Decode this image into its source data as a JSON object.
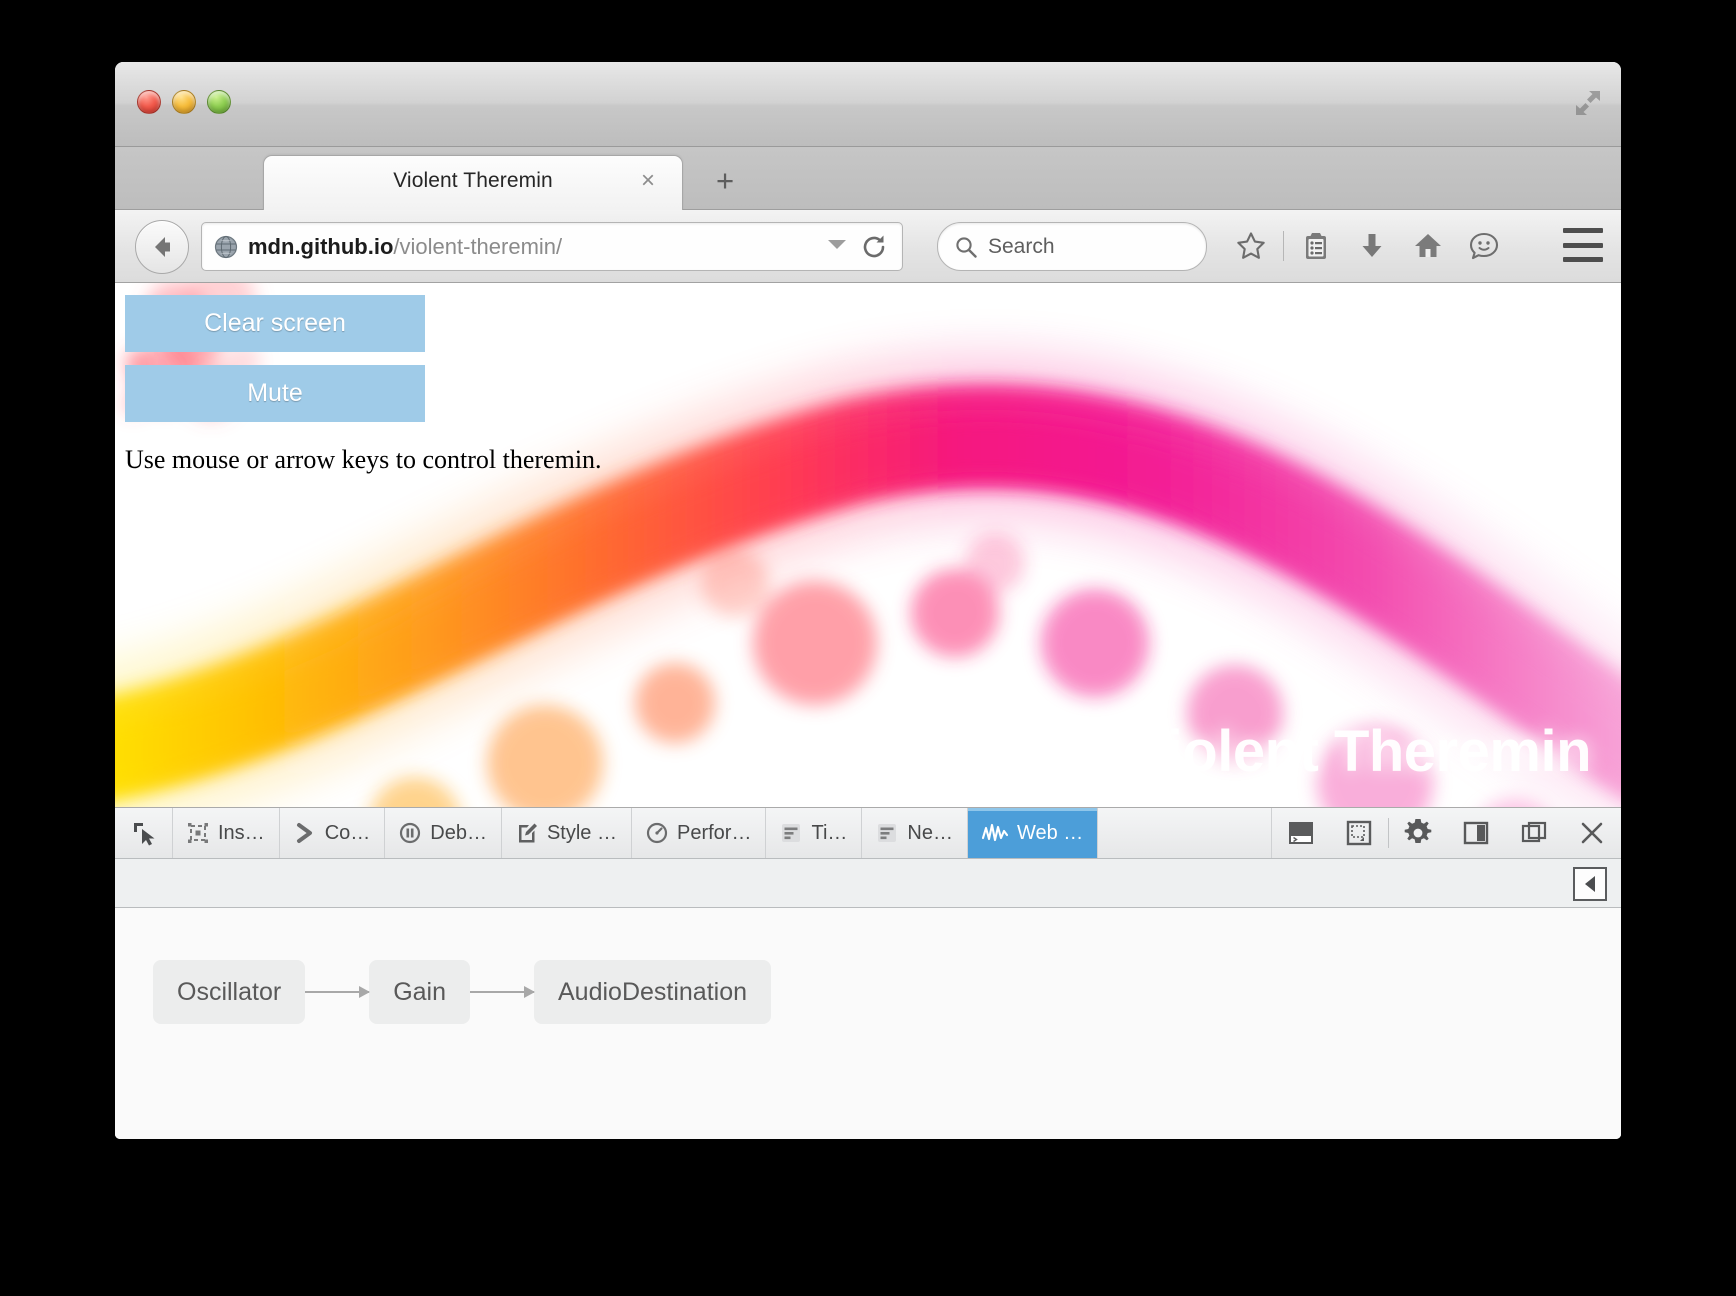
{
  "window": {
    "traffic_lights": [
      "close",
      "minimize",
      "zoom"
    ],
    "resize_grip": "resize-grip-icon"
  },
  "tabs": {
    "items": [
      {
        "title": "Violent Theremin",
        "close_label": "×",
        "active": true
      }
    ],
    "new_tab_label": "+"
  },
  "navbar": {
    "back_label": "Back",
    "url_host": "mdn.github.io",
    "url_path": "/violent-theremin/",
    "url_full": "mdn.github.io/violent-theremin/",
    "search_placeholder": "Search",
    "icons": [
      "bookmark-star-icon",
      "reading-list-icon",
      "downloads-icon",
      "home-icon",
      "feedback-smiley-icon",
      "menu-hamburger-icon"
    ]
  },
  "page": {
    "clear_button": "Clear screen",
    "mute_button": "Mute",
    "hint": "Use mouse or arrow keys to control theremin.",
    "watermark": "Violent Theremin"
  },
  "devtools": {
    "picker_tooltip": "Pick an element from the page",
    "tabs": [
      {
        "label": "Ins…",
        "icon": "inspector-icon",
        "active": false
      },
      {
        "label": "Co…",
        "icon": "console-icon",
        "active": false
      },
      {
        "label": "Deb…",
        "icon": "debugger-icon",
        "active": false
      },
      {
        "label": "Style …",
        "icon": "style-editor-icon",
        "active": false
      },
      {
        "label": "Perfor…",
        "icon": "performance-icon",
        "active": false
      },
      {
        "label": "Ti…",
        "icon": "timeline-icon",
        "active": false
      },
      {
        "label": "Ne…",
        "icon": "network-icon",
        "active": false
      },
      {
        "label": "Web …",
        "icon": "web-audio-icon",
        "active": true
      }
    ],
    "right_icons": [
      "split-console-icon",
      "responsive-design-icon",
      "settings-gear-icon",
      "dock-side-icon",
      "dock-window-icon",
      "close-devtools-icon"
    ],
    "collapse_label": "◀"
  },
  "web_audio_graph": {
    "nodes": [
      "Oscillator",
      "Gain",
      "AudioDestination"
    ],
    "edges": [
      {
        "from": "Oscillator",
        "to": "Gain"
      },
      {
        "from": "Gain",
        "to": "AudioDestination"
      }
    ]
  },
  "colors": {
    "accent_blue": "#4c9ed9",
    "button_blue": "#9fcbe8",
    "node_gray": "#eceded",
    "devtools_bg": "#f0f1f2"
  }
}
